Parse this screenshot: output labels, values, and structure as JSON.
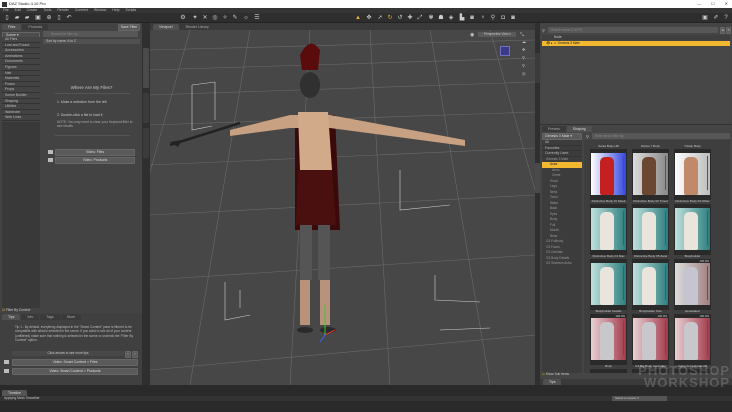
{
  "app": {
    "title": "DAZ Studio 4.10 Pro",
    "window_controls": [
      "—",
      "☐",
      "✕"
    ]
  },
  "menu": [
    "File",
    "Edit",
    "Create",
    "Tools",
    "Render",
    "Connect",
    "Window",
    "Help",
    "Scripts"
  ],
  "left_panel": {
    "tabs": [
      "Files",
      "Products"
    ],
    "save_filter": "Save Filter",
    "scope": "Scene",
    "search_placeholder": "Search for files by...",
    "sort": "Sort by name: A to Z",
    "categories": [
      "All Files",
      "Lost and Found",
      "Accessories",
      "Animations",
      "Documents",
      "Figures",
      "Hair",
      "Materials",
      "Poses",
      "Props",
      "Scene Builder",
      "Shaping",
      "Utilities",
      "Wardrobe",
      "Web Links"
    ],
    "heading": "Where Are My Files?",
    "step1": "1. Make a selection from the left",
    "step2": "2. Double-click a file to load it",
    "note": "NOTE: You may need to clear your Keyword filter to see results",
    "video_files": "Video: Files",
    "video_products": "Video: Products",
    "filter_by_context": "Filter By Context"
  },
  "tips": {
    "tabs": [
      "Tips",
      "Info",
      "Tags",
      "Store"
    ],
    "text": "Tip 1 - By default, everything displayed in the \"Smart Content\" pane is filtered to be compatible with what is selected in the scene. If you want to see all of your content (unfiltered) make sure that nothing is selected in the scene or uncheck the \"Filter By Context\" option.",
    "more": "Click arrows to see more tips",
    "video1": "Video: Smart Content > Files",
    "video2": "Video: Smart Content > Products"
  },
  "viewport": {
    "tabs": [
      "Viewport",
      "Render Library"
    ],
    "view": "Perspective View"
  },
  "scene": {
    "search_placeholder": "Search scene (Ctrl+F)",
    "column": "Node",
    "node": "Genesis 3 Male"
  },
  "shaping": {
    "tabs": [
      "Presets",
      "Shaping"
    ],
    "figure": "Genesis 3 Male",
    "search_placeholder": "Enter text to filter by...",
    "list": [
      "All",
      "Favorites",
      "Currently Used"
    ],
    "tree": [
      "Genesis 3 Male",
      "Actor",
      "Arms",
      "Chest",
      "Head",
      "Legs",
      "Neck",
      "Torso",
      "Waist",
      "Back",
      "Eyes",
      "Body",
      "Full",
      "Mouth",
      "Nose",
      "G3 Fullbody",
      "G3 Faces",
      "G3 Genitals",
      "G3 Body Details",
      "G3 Skeleton Actor"
    ],
    "selected": "Actor",
    "items": [
      {
        "name": "Santa Body HD",
        "kind": "santa"
      },
      {
        "name": "Darius 7 Body",
        "kind": "dark"
      },
      {
        "name": "Tristan Body",
        "kind": "tan"
      },
      {
        "name": "Distinctive Body 01 Sleek",
        "kind": "teal"
      },
      {
        "name": "Distinctive Body 02 Toned",
        "kind": "teal"
      },
      {
        "name": "Distinctive Body 03 Wider",
        "kind": "teal"
      },
      {
        "name": "Distinctive Body 04 Max",
        "kind": "teal"
      },
      {
        "name": "Distinctive Body 05 Zand",
        "kind": "teal"
      },
      {
        "name": "Bodybuilder",
        "kind": "grey",
        "value": "100.0%"
      },
      {
        "name": "Bodybuilder Details",
        "kind": "red",
        "value": "100.0%"
      },
      {
        "name": "Bodybuilder Size",
        "kind": "red",
        "value": "100.0%"
      },
      {
        "name": "Emaciated",
        "kind": "red",
        "value": "100.0%"
      },
      {
        "name": "Body",
        "kind": "red"
      },
      {
        "name": "G3 Big Body Controller",
        "kind": "violet"
      },
      {
        "name": "Aging Arms Detail HD",
        "kind": "violet"
      }
    ],
    "show_sub_items": "Show Sub Items",
    "bottom_tab": "Tips"
  },
  "bottom": {
    "tab": "Timeline",
    "status": "Applying Mesh Smoother",
    "lesson": "Select a Lesson",
    "watermark": "PHOTOSHOP WORKSHOP"
  },
  "colors": {
    "accent": "#e9b02c",
    "selection": "#f2b830"
  }
}
